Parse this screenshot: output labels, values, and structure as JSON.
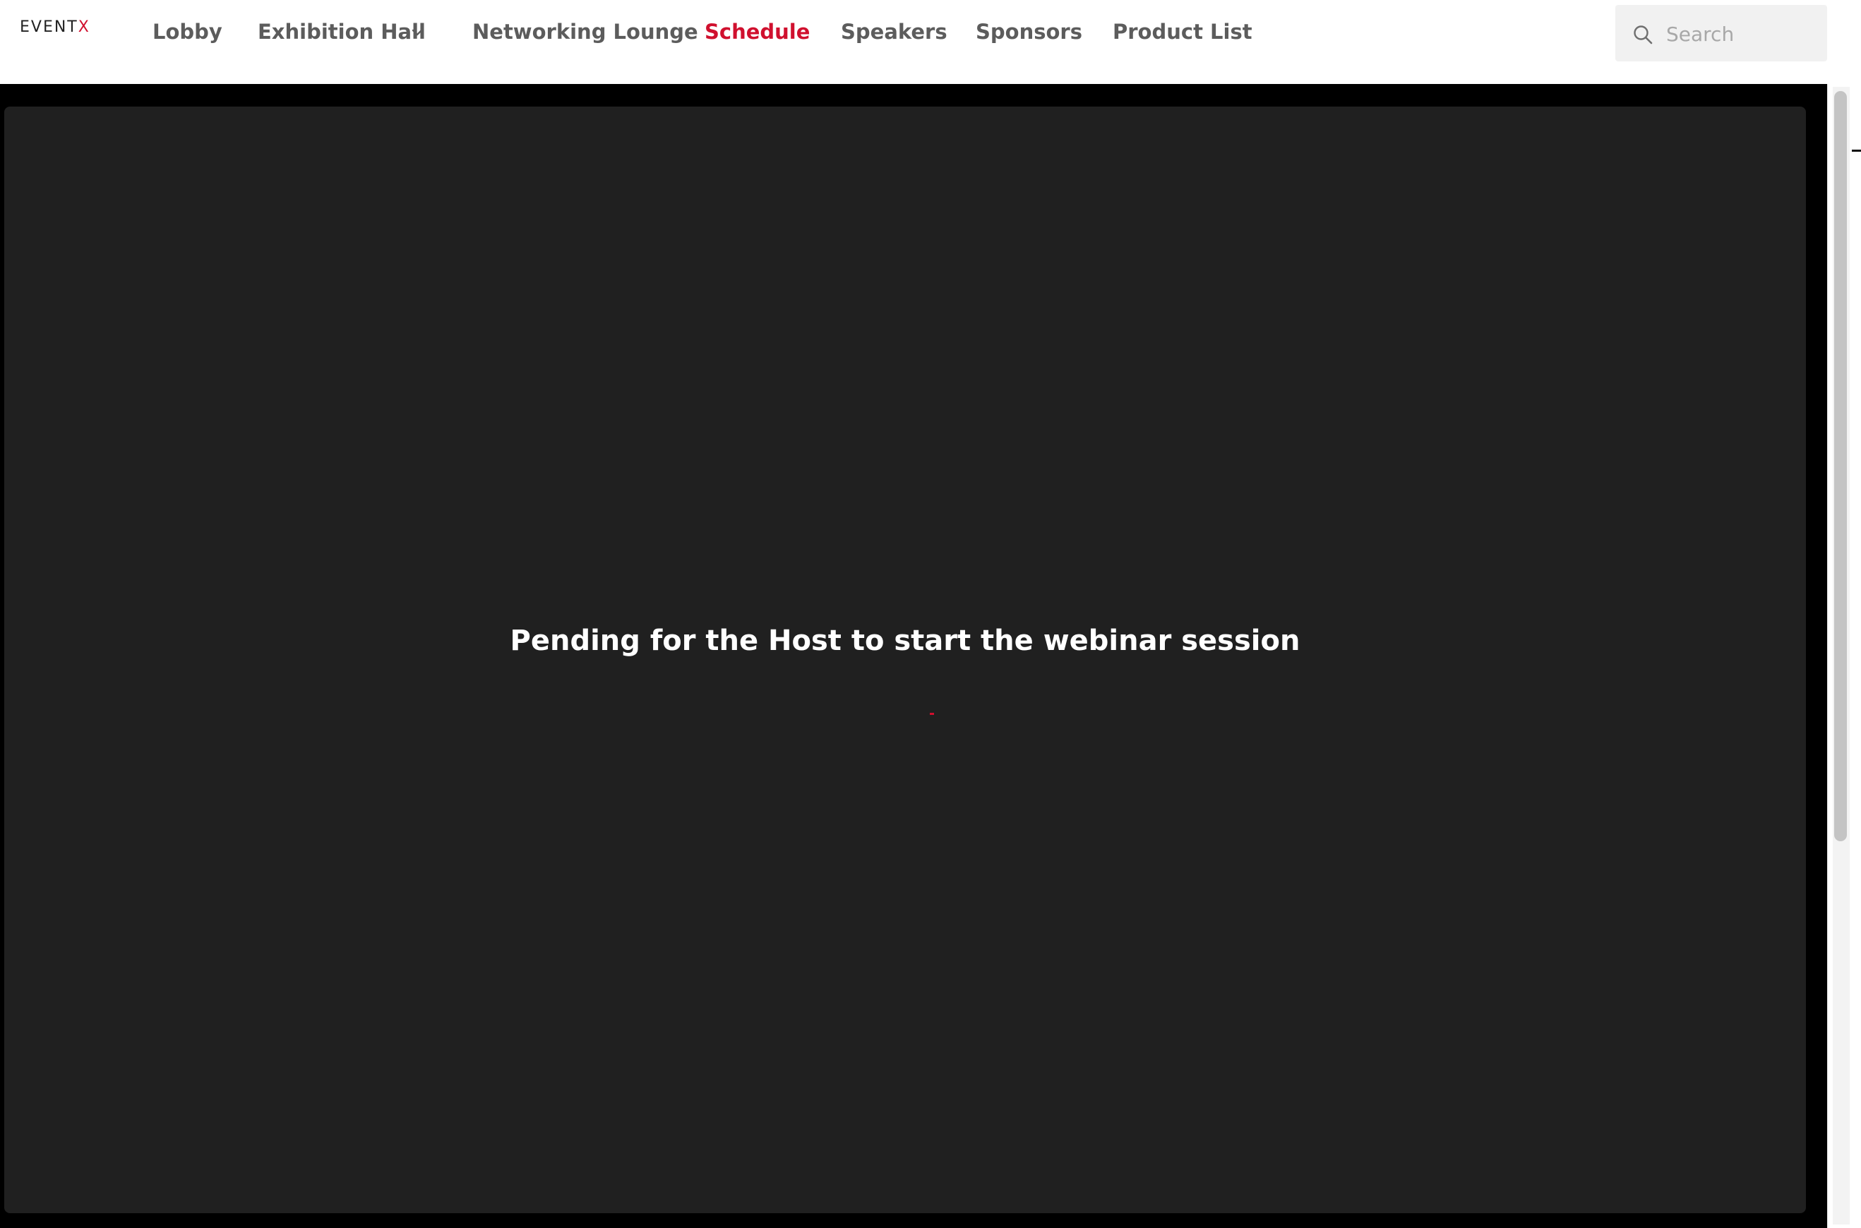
{
  "brand": {
    "logo_main": "EVENT",
    "logo_accent": "X",
    "accent_color": "#d0102e"
  },
  "nav": {
    "items": [
      {
        "label": "Lobby",
        "active": false
      },
      {
        "label": "Exhibition Hall",
        "active": false,
        "has_dropdown": true
      },
      {
        "label": "Networking Lounge",
        "active": false
      },
      {
        "label": "Schedule",
        "active": true
      },
      {
        "label": "Speakers",
        "active": false
      },
      {
        "label": "Sponsors",
        "active": false
      },
      {
        "label": "Product List",
        "active": false
      }
    ]
  },
  "search": {
    "placeholder": "Search",
    "icon": "search-icon"
  },
  "player": {
    "status_message": "Pending for the Host to start the webinar session",
    "background_color": "#202020"
  }
}
